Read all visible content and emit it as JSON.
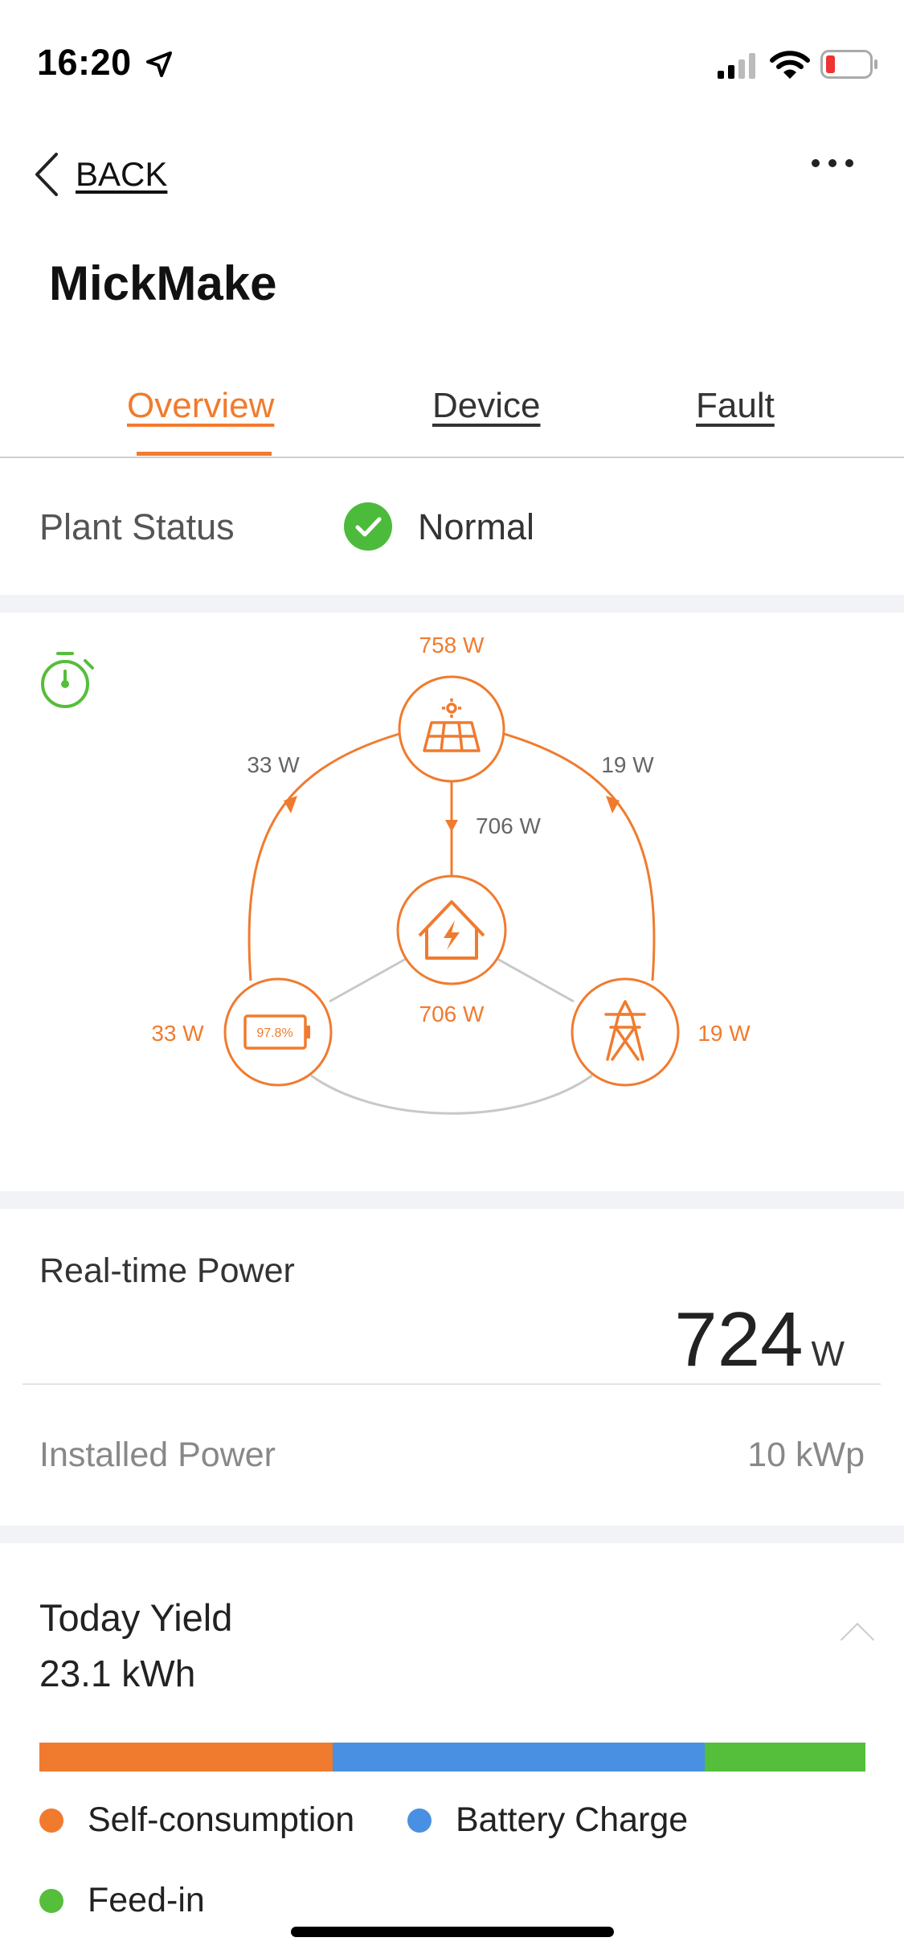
{
  "status_bar": {
    "time": "16:20"
  },
  "nav": {
    "back_label": "BACK",
    "more_icon": "more-horizontal-icon"
  },
  "page": {
    "title": "MickMake"
  },
  "tabs": [
    {
      "label": "Overview",
      "active": true
    },
    {
      "label": "Device",
      "active": false
    },
    {
      "label": "Fault",
      "active": false
    }
  ],
  "plant_status": {
    "label": "Plant Status",
    "value": "Normal",
    "icon": "check-circle-icon"
  },
  "flow": {
    "solar_power": "758 W",
    "solar_to_battery": "33 W",
    "solar_to_grid": "19 W",
    "solar_to_home": "706 W",
    "home_consumption": "706 W",
    "battery_power": "33 W",
    "battery_percent": "97.8%",
    "grid_power": "19 W"
  },
  "realtime": {
    "label": "Real-time Power",
    "value": "724",
    "unit": "W"
  },
  "installed": {
    "label": "Installed Power",
    "value": "10 kWp"
  },
  "today_yield": {
    "label": "Today Yield",
    "value": "23.1 kWh"
  },
  "yield_breakdown": {
    "segments": [
      {
        "name": "Self-consumption",
        "fraction": 0.355,
        "color": "#F07B2E"
      },
      {
        "name": "Battery Charge",
        "fraction": 0.45,
        "color": "#4A90E2"
      },
      {
        "name": "Feed-in",
        "fraction": 0.195,
        "color": "#55BE3B"
      }
    ]
  },
  "colors": {
    "accent": "#F07B2E",
    "ok": "#4CBB3C",
    "battery": "#4A90E2",
    "feed": "#55BE3B"
  }
}
